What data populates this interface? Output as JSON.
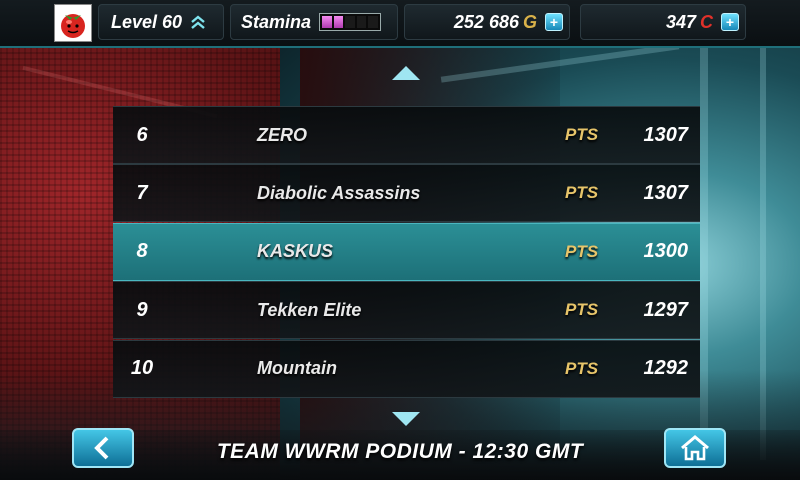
{
  "hud": {
    "level": "Level 60",
    "stamina_label": "Stamina",
    "stamina_filled": 2,
    "stamina_total": 5,
    "gold": "252 686",
    "gold_unit": "G",
    "coins": "347",
    "coins_unit": "C",
    "plus": "+"
  },
  "leaderboard": {
    "selected_rank": "8",
    "rows": [
      {
        "rank": "6",
        "team": "ZERO",
        "pts_label": "PTS",
        "points": "1307"
      },
      {
        "rank": "7",
        "team": "Diabolic Assassins",
        "pts_label": "PTS",
        "points": "1307"
      },
      {
        "rank": "8",
        "team": "KASKUS",
        "pts_label": "PTS",
        "points": "1300"
      },
      {
        "rank": "9",
        "team": "Tekken Elite",
        "pts_label": "PTS",
        "points": "1297"
      },
      {
        "rank": "10",
        "team": "Mountain",
        "pts_label": "PTS",
        "points": "1292"
      }
    ]
  },
  "footer": {
    "title": "TEAM WWRM PODIUM - 12:30 GMT"
  },
  "icons": {
    "avatar": "tomato-icon",
    "back": "chevron-left-icon",
    "home": "home-icon",
    "scroll_up": "arrow-up-icon",
    "scroll_down": "arrow-down-icon"
  },
  "colors": {
    "accent": "#1f8a93",
    "gold": "#d9b24a",
    "coin": "#e0312a",
    "stamina": "#d65ad0"
  }
}
